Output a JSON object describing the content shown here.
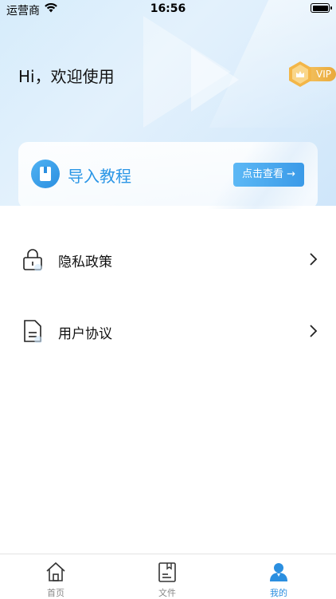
{
  "status_bar": {
    "carrier": "运营商",
    "time": "16:56"
  },
  "header": {
    "greeting": "Hi，欢迎使用",
    "vip_label": "VIP"
  },
  "tutorial_card": {
    "title": "导入教程",
    "button_label": "点击查看 →",
    "icon": "book-icon"
  },
  "menu": {
    "items": [
      {
        "label": "隐私政策",
        "icon": "lock-icon"
      },
      {
        "label": "用户协议",
        "icon": "document-icon"
      }
    ]
  },
  "tab_bar": {
    "tabs": [
      {
        "label": "首页",
        "icon": "home-icon",
        "active": false
      },
      {
        "label": "文件",
        "icon": "file-icon",
        "active": false
      },
      {
        "label": "我的",
        "icon": "user-icon",
        "active": true
      }
    ]
  },
  "colors": {
    "accent": "#2b8fe0",
    "vip_gold": "#f0b44c"
  }
}
